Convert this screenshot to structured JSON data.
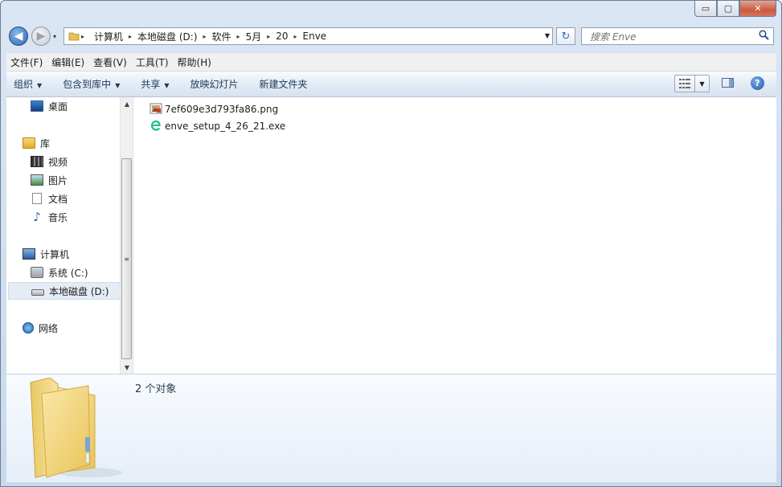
{
  "window": {
    "caption_buttons": {
      "minimize": "▭",
      "maximize": "▢",
      "close": "✕"
    }
  },
  "nav": {
    "back_glyph": "◀",
    "forward_glyph": "▶",
    "history_glyph": "▾",
    "refresh_glyph": "↻",
    "breadcrumbs": [
      "计算机",
      "本地磁盘 (D:)",
      "软件",
      "5月",
      "20",
      "Enve"
    ],
    "crumb_separator": "▸",
    "address_dropdown_glyph": "▼",
    "search_placeholder": "搜索 Enve",
    "search_icon": "search-icon"
  },
  "menubar": [
    "文件(F)",
    "编辑(E)",
    "查看(V)",
    "工具(T)",
    "帮助(H)"
  ],
  "toolbar": {
    "organize": "组织",
    "include_in_library": "包含到库中",
    "share": "共享",
    "slideshow": "放映幻灯片",
    "new_folder": "新建文件夹",
    "dropdown_glyph": "▼",
    "view_icon": "view-mode-icon",
    "help_glyph": "?"
  },
  "sidebar": {
    "desktop": "桌面",
    "libraries": "库",
    "videos": "视频",
    "pictures": "图片",
    "documents": "文档",
    "music": "音乐",
    "computer": "计算机",
    "drive_c": "系统 (C:)",
    "drive_d": "本地磁盘 (D:)",
    "network": "网络",
    "scroll_up": "▲",
    "scroll_down": "▼",
    "grip": "≡"
  },
  "files": [
    {
      "name": "7ef609e3d793fa86.png",
      "icon": "png-image-icon"
    },
    {
      "name": "enve_setup_4_26_21.exe",
      "icon": "enve-app-icon"
    }
  ],
  "details": {
    "count": "2 个对象",
    "icon": "folder-icon"
  },
  "colors": {
    "accent_blue": "#2f66b0",
    "selection": "#e4ecf5",
    "close_red": "#c85a41"
  }
}
